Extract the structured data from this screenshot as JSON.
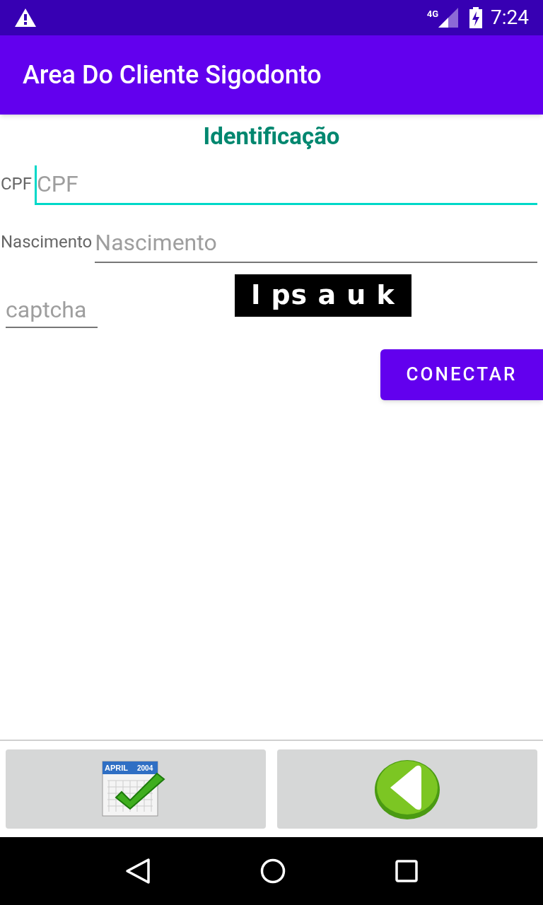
{
  "status_bar": {
    "network": "4G",
    "time": "7:24"
  },
  "app_bar": {
    "title": "Area Do Cliente Sigodonto"
  },
  "form": {
    "heading": "Identificação",
    "fields": [
      {
        "label": "CPF",
        "placeholder": "CPF",
        "focused": true
      },
      {
        "label": "Nascimento",
        "placeholder": "Nascimento",
        "focused": false
      }
    ],
    "captcha": {
      "placeholder": "captcha",
      "code": "l ps a u k"
    },
    "submit": "CONECTAR"
  },
  "bottom_buttons": [
    {
      "kind": "calendar",
      "month": "APRIL",
      "year": "2004"
    },
    {
      "kind": "back"
    }
  ]
}
